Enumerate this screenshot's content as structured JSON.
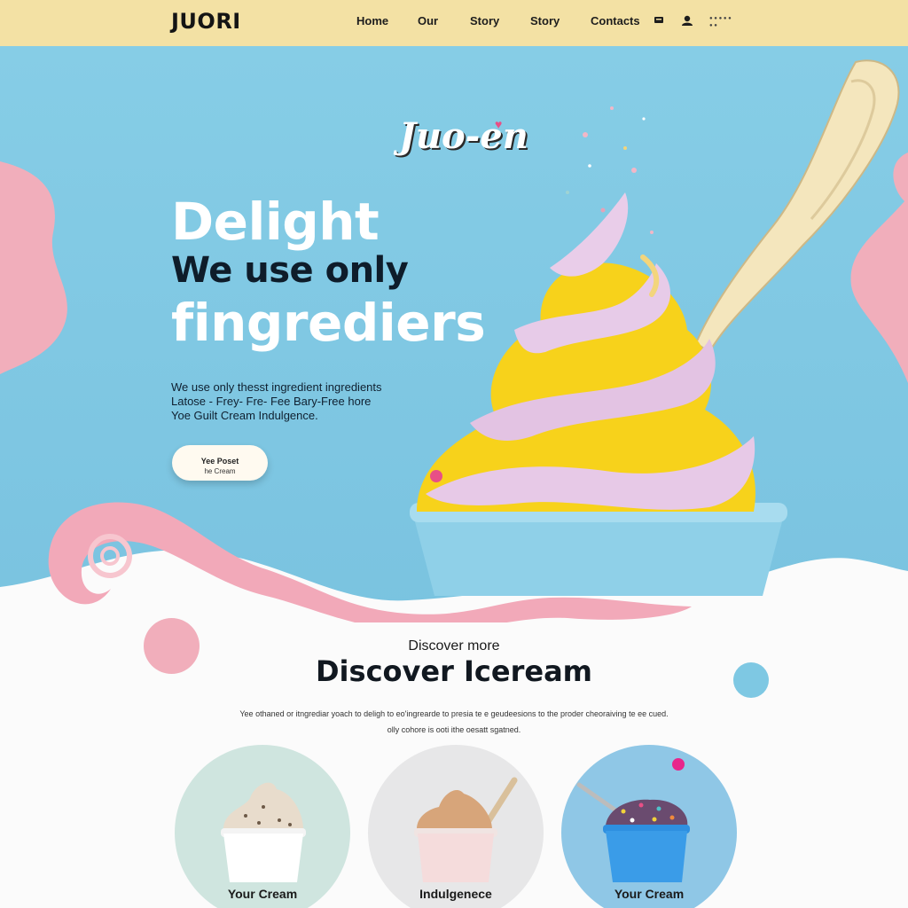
{
  "nav": {
    "logo": "JUORI",
    "links": [
      "Home",
      "Our",
      "Story",
      "Story",
      "Contacts"
    ],
    "icons": [
      "cart-icon",
      "user-icon"
    ],
    "extra_text": "● ● ● ● ● ● ●"
  },
  "hero": {
    "script_logo": "Juo-en",
    "headline_1": "Delight",
    "headline_2": "We use only",
    "headline_3": "fingrediers",
    "description": [
      "We use only thesst ingredient ingredients",
      "Latose ‑ Frey‑ Fre‑ Fee Bary‑Free hore",
      "Yoe Guilt Cream Indulgence."
    ],
    "cta_line1": "Yee Poset",
    "cta_line2": "he Cream"
  },
  "discover": {
    "kicker": "Discover more",
    "title": "Discover Iceream",
    "description": [
      "Yee othaned or itngrediar yoach to deligh to eo'ingrearde to presia te e geudeesions to the proder cheoraiving te ee cued.",
      "olly cohore is ooti ithe oesatt sgatned."
    ],
    "cards": [
      {
        "label": "Your Cream",
        "bg": "#cfe5df"
      },
      {
        "label": "Indulgenece",
        "bg": "#e7e7e8"
      },
      {
        "label": "Your Cream",
        "bg": "#8fc7e6"
      }
    ]
  },
  "colors": {
    "nav_bg": "#f3e1a4",
    "hero_bg": "#7ec8e3",
    "pink": "#f0a8b6",
    "yellow": "#f7d21b",
    "lavender": "#e7c9e7"
  }
}
